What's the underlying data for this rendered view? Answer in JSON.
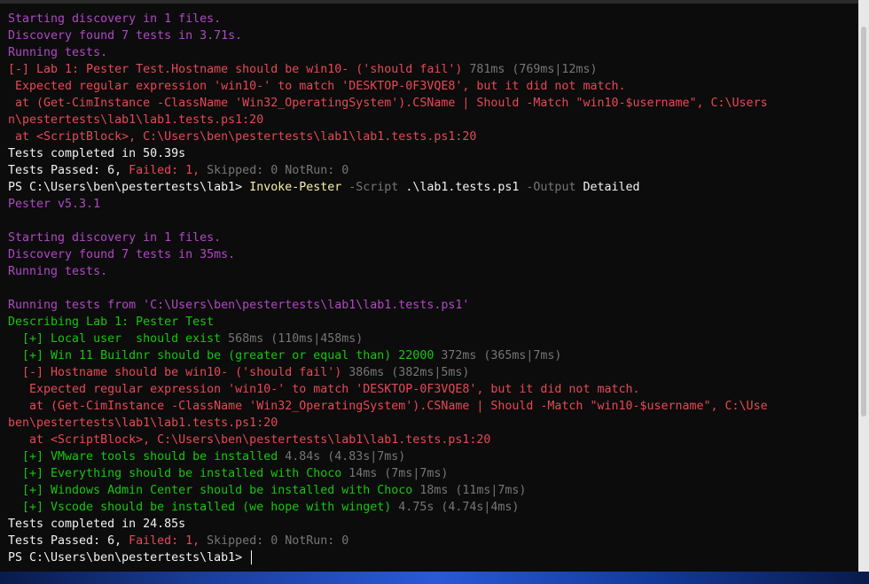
{
  "run1": {
    "discovery_start": "Starting discovery in 1 files.",
    "discovery_found": "Discovery found 7 tests in 3.71s.",
    "running": "Running tests.",
    "fail_line": "[-] Lab 1: Pester Test.Hostname should be win10- ('should fail')",
    "fail_timing": " 781ms (769ms|12ms)",
    "expected": " Expected regular expression 'win10-' to match 'DESKTOP-0F3VQE8', but it did not match.",
    "at_line1": " at (Get-CimInstance -ClassName 'Win32_OperatingSystem').CSName | Should -Match \"win10-$username\", C:\\Users",
    "at_line2": "n\\pestertests\\lab1\\lab1.tests.ps1:20",
    "at_scriptblock": " at <ScriptBlock>, C:\\Users\\ben\\pestertests\\lab1\\lab1.tests.ps1:20",
    "completed": "Tests completed in 50.39s",
    "summary": {
      "passed": "Tests Passed: 6, ",
      "failed": "Failed: 1, ",
      "skipped": "Skipped: 0 ",
      "notrun": "NotRun: 0"
    }
  },
  "command": {
    "prompt": "PS C:\\Users\\ben\\pestertests\\lab1> ",
    "cmdlet": "Invoke-Pester",
    "param_script": " -Script",
    "arg_script": " .\\lab1.tests.ps1",
    "param_output": " -Output",
    "arg_output": " Detailed"
  },
  "run2": {
    "version": "Pester v5.3.1",
    "discovery_start": "Starting discovery in 1 files.",
    "discovery_found": "Discovery found 7 tests in 35ms.",
    "running": "Running tests.",
    "running_from": "Running tests from 'C:\\Users\\ben\\pestertests\\lab1\\lab1.tests.ps1'",
    "describing": "Describing Lab 1: Pester Test",
    "tests": [
      {
        "text": "  [+] Local user  should exist",
        "timing": " 568ms (110ms|458ms)"
      },
      {
        "text": "  [+] Win 11 Buildnr should be (greater or equal than) 22000",
        "timing": " 372ms (365ms|7ms)"
      }
    ],
    "fail_line": "  [-] Hostname should be win10- ('should fail')",
    "fail_timing": " 386ms (382ms|5ms)",
    "expected": "   Expected regular expression 'win10-' to match 'DESKTOP-0F3VQE8', but it did not match.",
    "at_line1": "   at (Get-CimInstance -ClassName 'Win32_OperatingSystem').CSName | Should -Match \"win10-$username\", C:\\Use",
    "at_line2": "ben\\pestertests\\lab1\\lab1.tests.ps1:20",
    "at_scriptblock": "   at <ScriptBlock>, C:\\Users\\ben\\pestertests\\lab1\\lab1.tests.ps1:20",
    "tests_after": [
      {
        "text": "  [+] VMware tools should be installed",
        "timing": " 4.84s (4.83s|7ms)"
      },
      {
        "text": "  [+] Everything should be installed with Choco",
        "timing": " 14ms (7ms|7ms)"
      },
      {
        "text": "  [+] Windows Admin Center should be installed with Choco",
        "timing": " 18ms (11ms|7ms)"
      },
      {
        "text": "  [+] Vscode should be installed (we hope with winget)",
        "timing": " 4.75s (4.74s|4ms)"
      }
    ],
    "completed": "Tests completed in 24.85s",
    "summary": {
      "passed": "Tests Passed: 6, ",
      "failed": "Failed: 1, ",
      "skipped": "Skipped: 0 ",
      "notrun": "NotRun: 0"
    },
    "final_prompt": "PS C:\\Users\\ben\\pestertests\\lab1> "
  },
  "colors": {
    "background": "#0c0c0c",
    "magenta": "#b148c6",
    "red": "#e74856",
    "green": "#16c60c",
    "white": "#f2f2f2",
    "gray": "#767676",
    "yellow": "#f9f1a5"
  }
}
